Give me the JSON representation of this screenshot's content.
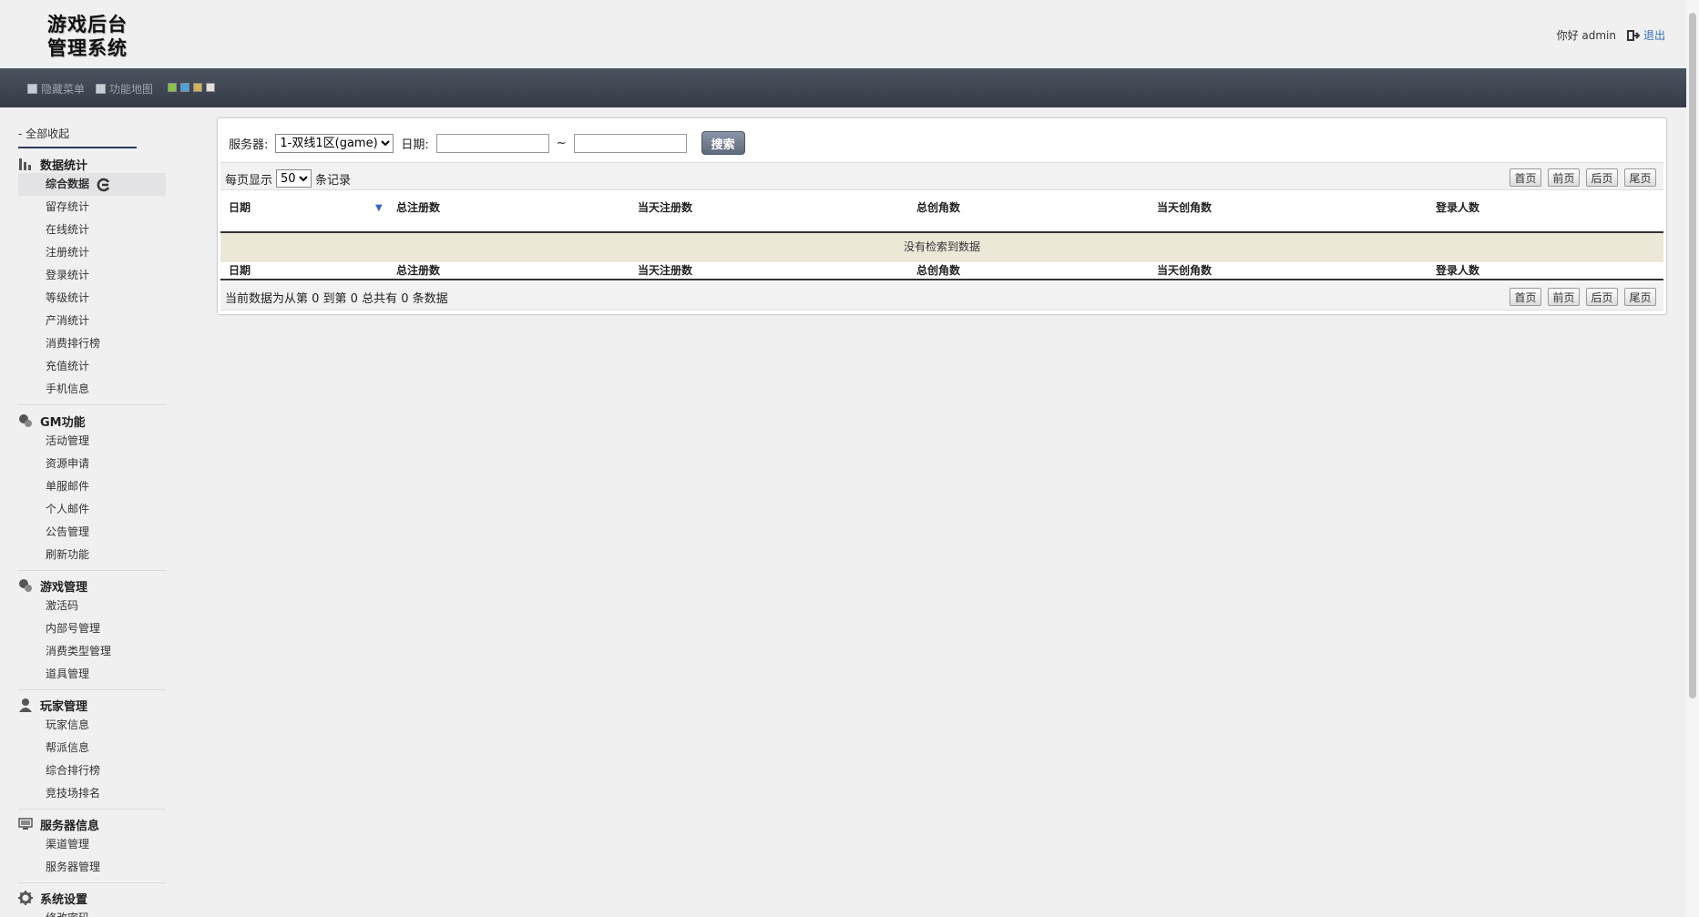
{
  "header": {
    "logo_line1": "游戏后台",
    "logo_line2": "管理系统",
    "greeting": "你好 admin",
    "logout": "退出"
  },
  "toolbar": {
    "hide_menu": "隐藏菜单",
    "function_map": "功能地图",
    "theme_colors": [
      "#8bc34a",
      "#4aa3df",
      "#d4b25a",
      "#e0e0e0"
    ]
  },
  "sidebar": {
    "collapse_all": "- 全部收起",
    "sections": [
      {
        "title": "数据统计",
        "icon": "bar-chart-icon",
        "items": [
          "综合数据",
          "留存统计",
          "在线统计",
          "注册统计",
          "登录统计",
          "等级统计",
          "产消统计",
          "消费排行榜",
          "充值统计",
          "手机信息"
        ]
      },
      {
        "title": "GM功能",
        "icon": "gm-icon",
        "items": [
          "活动管理",
          "资源申请",
          "单服邮件",
          "个人邮件",
          "公告管理",
          "刷新功能"
        ]
      },
      {
        "title": "游戏管理",
        "icon": "game-icon",
        "items": [
          "激活码",
          "内部号管理",
          "消费类型管理",
          "道具管理"
        ]
      },
      {
        "title": "玩家管理",
        "icon": "user-icon",
        "items": [
          "玩家信息",
          "帮派信息",
          "综合排行榜",
          "竞技场排名"
        ]
      },
      {
        "title": "服务器信息",
        "icon": "server-icon",
        "items": [
          "渠道管理",
          "服务器管理"
        ]
      },
      {
        "title": "系统设置",
        "icon": "gear-icon",
        "items": [
          "修改密码"
        ]
      }
    ]
  },
  "filters": {
    "server_label": "服务器:",
    "server_value": "1-双线1区(game)",
    "date_label": "日期:",
    "date_from": "",
    "date_to": "",
    "tilde": "~",
    "search_button": "搜索"
  },
  "pager": {
    "per_page_prefix": "每页显示",
    "per_page_value": "50",
    "per_page_suffix": "条记录",
    "first": "首页",
    "prev": "前页",
    "next": "后页",
    "last": "尾页",
    "summary": "当前数据为从第 0 到第 0 总共有 0 条数据"
  },
  "table": {
    "columns": [
      "日期",
      "总注册数",
      "当天注册数",
      "总创角数",
      "当天创角数",
      "登录人数"
    ],
    "empty_message": "没有检索到数据"
  }
}
